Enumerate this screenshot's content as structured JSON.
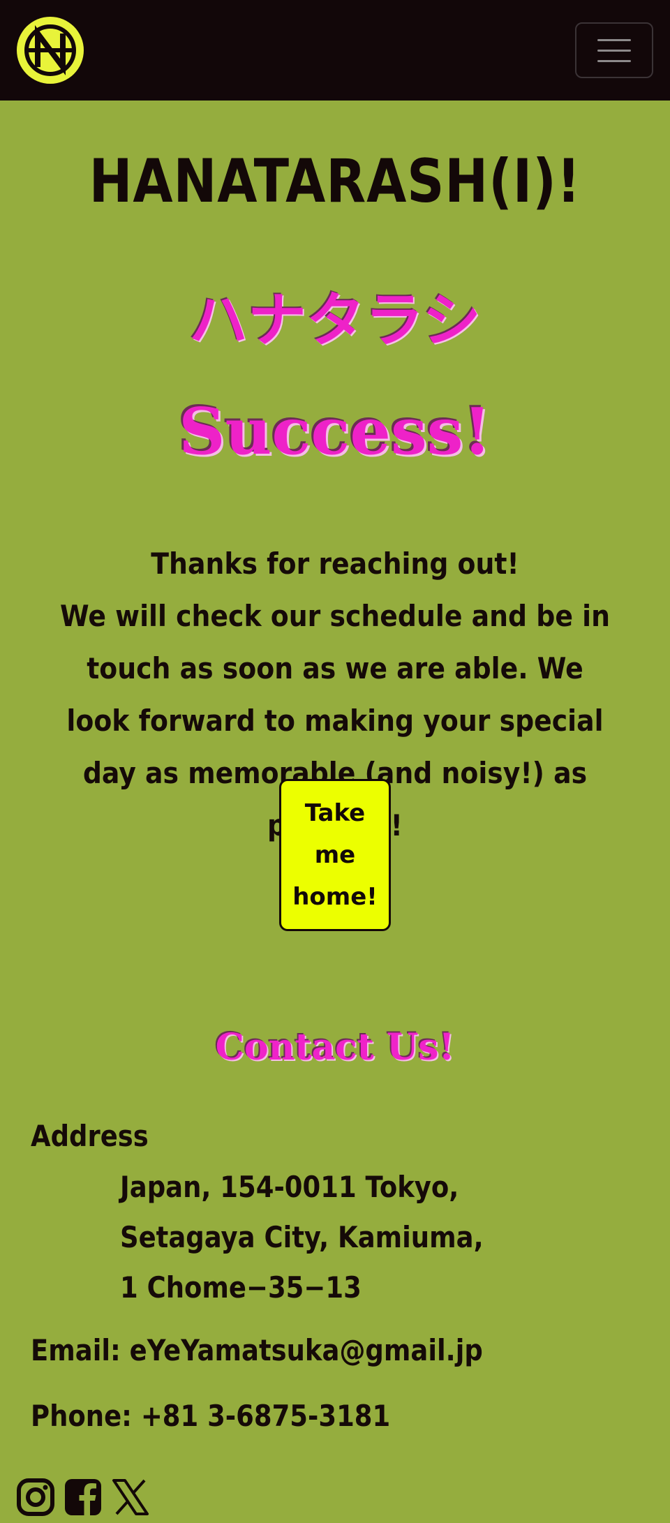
{
  "navbar": {
    "logo_icon": "hanatarashi-logo-icon",
    "menu_icon": "hamburger-menu-icon"
  },
  "hero": {
    "title": "HANATARASH(I)!",
    "kana": "ハナタラシ",
    "status": "Success!"
  },
  "message": {
    "line1": "Thanks for reaching out!",
    "line2": "We will check our schedule and be in touch as soon as we are able. We look forward to making your special day as memorable (and noisy!) as possible!"
  },
  "home_button": {
    "label": "Take me home!"
  },
  "contact": {
    "title": "Contact Us!",
    "address_label": "Address",
    "address_lines": [
      "Japan, 154-0011 Tokyo,",
      "Setagaya City, Kamiuma,",
      "1 Chome−35−13"
    ],
    "email": "Email: eYeYamatsuka@gmail.jp",
    "phone": "Phone: +81 3-6875-3181"
  },
  "socials": [
    "instagram-icon",
    "facebook-icon",
    "x-twitter-icon"
  ],
  "colors": {
    "background": "#95ad3e",
    "navbar": "#120709",
    "accent_pink": "#ee22c8",
    "button_yellow": "#ecff00",
    "logo_yellow": "#e8f33a"
  }
}
